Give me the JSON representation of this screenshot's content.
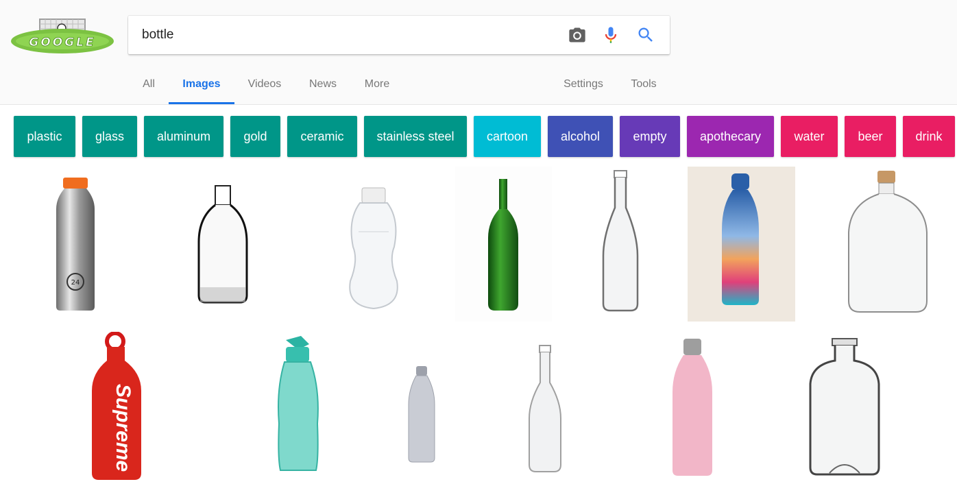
{
  "search": {
    "query": "bottle"
  },
  "icons": {
    "camera": "camera-icon",
    "mic": "microphone-icon",
    "search": "search-icon",
    "logo": "google-doodle-logo"
  },
  "logo": {
    "text": "GOOGLE"
  },
  "tabs": [
    {
      "label": "All",
      "active": false
    },
    {
      "label": "Images",
      "active": true
    },
    {
      "label": "Videos",
      "active": false
    },
    {
      "label": "News",
      "active": false
    },
    {
      "label": "More",
      "active": false
    }
  ],
  "settings_label": "Settings",
  "tools_label": "Tools",
  "chips": [
    {
      "label": "plastic",
      "color": "#009688"
    },
    {
      "label": "glass",
      "color": "#009688"
    },
    {
      "label": "aluminum",
      "color": "#009688"
    },
    {
      "label": "gold",
      "color": "#009688"
    },
    {
      "label": "ceramic",
      "color": "#009688"
    },
    {
      "label": "stainless steel",
      "color": "#009688"
    },
    {
      "label": "cartoon",
      "color": "#00bcd4"
    },
    {
      "label": "alcohol",
      "color": "#3f51b5"
    },
    {
      "label": "empty",
      "color": "#673ab7"
    },
    {
      "label": "apothecary",
      "color": "#9c27b0"
    },
    {
      "label": "water",
      "color": "#e91e63"
    },
    {
      "label": "beer",
      "color": "#e91e63"
    },
    {
      "label": "drink",
      "color": "#e91e63"
    }
  ],
  "results": [
    {
      "kind": "stainless-bottle"
    },
    {
      "kind": "clear-glass-bottle"
    },
    {
      "kind": "plastic-water-bottle"
    },
    {
      "kind": "green-wine-bottle"
    },
    {
      "kind": "clear-soda-bottle"
    },
    {
      "kind": "iridescent-bottle"
    },
    {
      "kind": "cork-apothecary-bottle"
    },
    {
      "kind": "red-supreme-bottle",
      "label": "Supreme"
    },
    {
      "kind": "teal-plastic-bottle"
    },
    {
      "kind": "silver-swell-bottle"
    },
    {
      "kind": "clear-beer-bottle"
    },
    {
      "kind": "pink-swell-bottle"
    },
    {
      "kind": "glass-decanter-bottle"
    }
  ]
}
